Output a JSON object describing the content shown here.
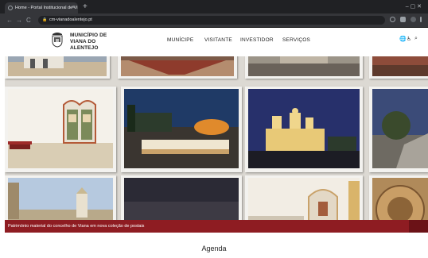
{
  "browser": {
    "tab_title": "Home - Portal Institucional de Vi",
    "tab_close": "×",
    "new_tab": "+",
    "window_controls": "–  ▢  ✕",
    "back": "←",
    "forward": "→",
    "reload": "C",
    "home": "⌂",
    "url": "cm-vianadoalentejo.pt",
    "lock": "🔒"
  },
  "header": {
    "brand_line1": "MUNICÍPIO DE",
    "brand_line2": "VIANA DO",
    "brand_line3": "ALENTEJO",
    "menu": {
      "municipe": "MUNÍCIPE",
      "visitante": "VISITANTE",
      "investidor": "INVESTIDOR",
      "servicos": "SERVIÇOS"
    },
    "icons": {
      "globe": "🌐",
      "accessibility": "♿",
      "search": "⌕"
    }
  },
  "hero": {
    "caption": "Património material do concelho de Viana em nova coleção de postais"
  },
  "section": {
    "agenda": "Agenda"
  },
  "colors": {
    "caption_bar": "#8e1c22",
    "chrome_dark": "#202124"
  }
}
